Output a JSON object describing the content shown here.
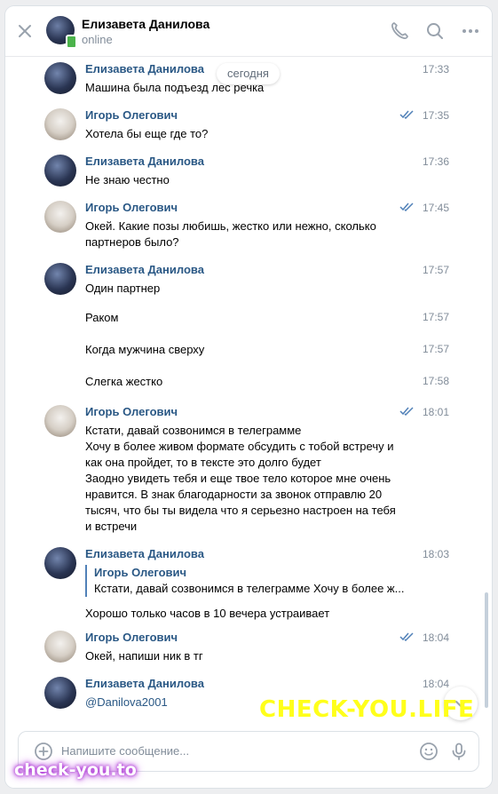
{
  "header": {
    "name": "Елизавета Данилова",
    "status": "online",
    "close_icon": "close-icon",
    "call_icon": "phone-icon",
    "search_icon": "search-icon",
    "more_icon": "more-icon"
  },
  "date_divider": "сегодня",
  "messages": [
    {
      "author": "Елизавета Данилова",
      "time": "17:33",
      "text": "Машина была подъезд лес речка"
    },
    {
      "author": "Игорь Олегович",
      "time": "17:35",
      "read": true,
      "text": "Хотела бы еще где то?"
    },
    {
      "author": "Елизавета Данилова",
      "time": "17:36",
      "text": "Не знаю честно"
    },
    {
      "author": "Игорь Олегович",
      "time": "17:45",
      "read": true,
      "text_lines": [
        "Окей. Какие позы любишь, жестко или нежно, сколько",
        "партнеров было?"
      ]
    },
    {
      "author": "Елизавета Данилова",
      "time": "17:57",
      "text": "Один партнер"
    },
    {
      "time": "17:57",
      "text": "Раком"
    },
    {
      "time": "17:57",
      "text": "Когда мужчина сверху"
    },
    {
      "time": "17:58",
      "text": "Слегка жестко"
    },
    {
      "author": "Игорь Олегович",
      "time": "18:01",
      "read": true,
      "text_lines": [
        "Кстати, давай созвонимся в телеграмме",
        "Хочу в более живом формате обсудить с тобой встречу и",
        "как она пройдет, то в тексте это долго будет",
        "Заодно увидеть тебя и еще твое тело которое мне очень",
        "нравится. В знак благодарности за звонок отправлю 20",
        "тысяч, что бы ты видела что я серьезно настроен на тебя",
        "и встречи"
      ]
    },
    {
      "author": "Елизавета Данилова",
      "time": "18:03",
      "quote": {
        "author": "Игорь Олегович",
        "text": "Кстати, давай созвонимся в телеграмме Хочу в более ж..."
      },
      "text": "Хорошо только часов в 10 вечера устраивает"
    },
    {
      "author": "Игорь Олегович",
      "time": "18:04",
      "read": true,
      "text": "Окей, напиши ник в тг"
    },
    {
      "author": "Елизавета Данилова",
      "time": "18:04",
      "text": "@Danilova2001"
    }
  ],
  "composer": {
    "placeholder": "Напишите сообщение...",
    "attach_icon": "plus-icon",
    "emoji_icon": "emoji-icon",
    "mic_icon": "microphone-icon"
  },
  "watermarks": {
    "top": "CHECK-YOU.LIFE",
    "bottom": "check-you.to"
  },
  "colors": {
    "author": "#2a5885",
    "online": "#4bb34b",
    "watermark_yellow": "#ffff1a",
    "watermark_glow": "#b03ad8"
  }
}
